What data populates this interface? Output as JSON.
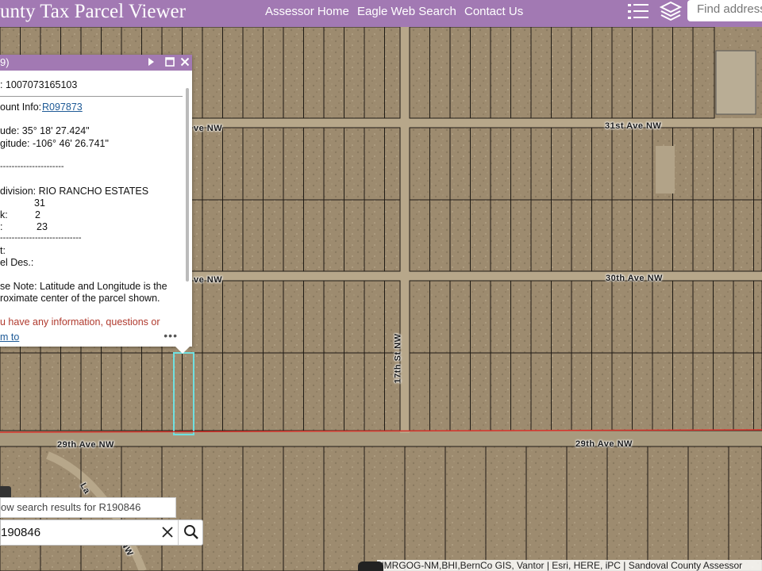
{
  "header": {
    "title": "unty Tax Parcel Viewer",
    "nav": [
      "Assessor Home",
      "Eagle Web Search",
      "Contact Us"
    ],
    "search_placeholder": "Find address",
    "icons": [
      "list-icon",
      "layers-icon"
    ]
  },
  "popup": {
    "title_fragment": "9)",
    "parcel_line": ": 1007073165103",
    "account_label": "ount Info:",
    "account_link": "R097873",
    "latitude": "ude: 35° 18' 27.424\"",
    "longitude": "gitude: -106° 46' 26.741\"",
    "divider1": "----------------------",
    "subdivision": "division: RIO RANCHO ESTATES",
    "unit_value": "31",
    "block_label": "k:",
    "block_value": "2",
    "lot_label": ":",
    "lot_value": "23",
    "divider2": "----------------------------",
    "line_t": "t:",
    "parcel_des": "el Des.:",
    "note1": "se Note: Latitude and Longitude is the",
    "note2": "roximate center of the parcel shown.",
    "info_line": "u have any information, questions or",
    "link_fragment": "m to",
    "more": "•••"
  },
  "map_labels": {
    "road_31st": "31st Ave NW",
    "road_31st_left": "ve NW",
    "road_30th": "30th Ave NW",
    "road_30th_left": "ve NW",
    "road_29th_left": "29th Ave NW",
    "road_29th_right": "29th Ave NW",
    "road_17th": "17th St NW",
    "road_la": "La",
    "road_nw": "NW"
  },
  "search": {
    "hint": "ow search results for R190846",
    "value": "190846"
  },
  "attribution": "NMRGOG-NM,BHI,BernCo GIS, Vantor | Esri, HERE, iPC | Sandoval County Assessor",
  "colors": {
    "header": "#a279b3",
    "terrain": "#9c8a6e",
    "parcel_line": "#1e1a14",
    "selected_parcel": "#6fe0e0",
    "highlight_road": "#d8322a"
  }
}
